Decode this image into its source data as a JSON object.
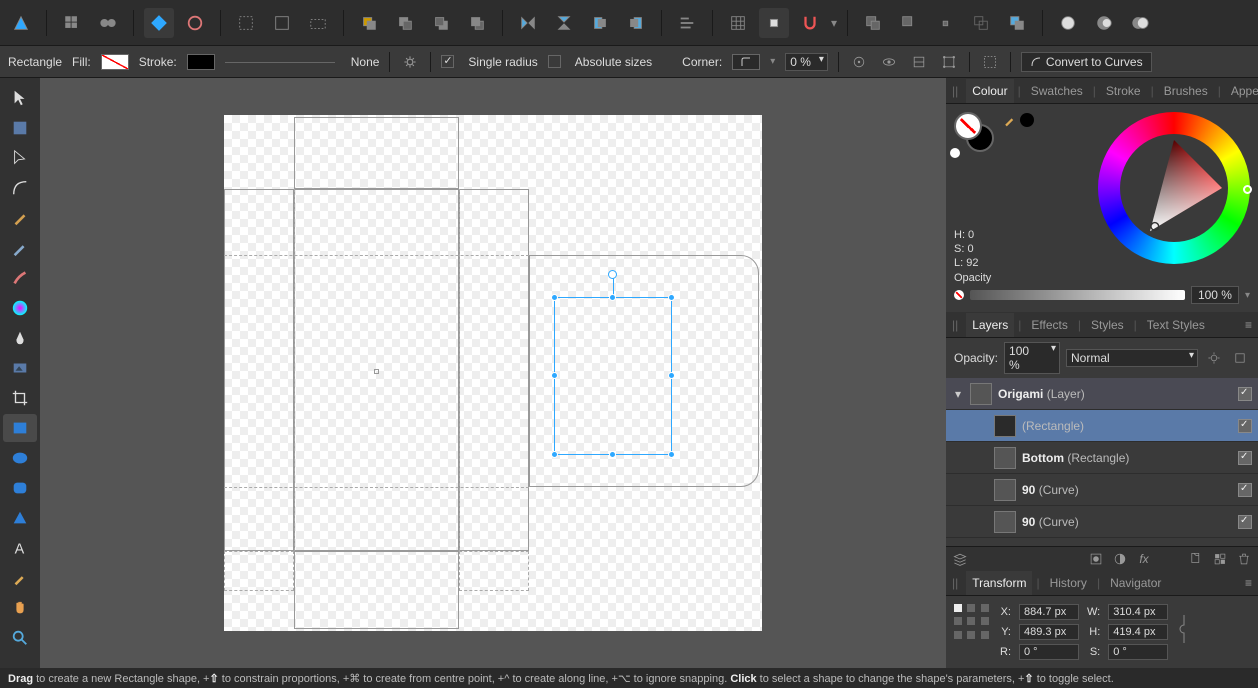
{
  "app": {
    "name": "Affinity Designer"
  },
  "context": {
    "tool_name": "Rectangle",
    "fill_label": "Fill:",
    "stroke_label": "Stroke:",
    "stroke_width_label": "None",
    "single_radius_label": "Single radius",
    "absolute_sizes_label": "Absolute sizes",
    "corner_label": "Corner:",
    "corner_value": "0 %",
    "convert_label": "Convert to Curves"
  },
  "color_panel": {
    "tabs": [
      "Colour",
      "Swatches",
      "Stroke",
      "Brushes",
      "Appearance"
    ],
    "hsl": {
      "h": "H: 0",
      "s": "S: 0",
      "l": "L: 92"
    },
    "opacity_label": "Opacity",
    "opacity_value": "100 %"
  },
  "layers_panel": {
    "tabs": [
      "Layers",
      "Effects",
      "Styles",
      "Text Styles"
    ],
    "opacity_label": "Opacity:",
    "opacity_value": "100 %",
    "blend_mode": "Normal",
    "items": [
      {
        "name": "Origami",
        "type": "(Layer)",
        "indent": 0,
        "group": true,
        "open": true,
        "visible": true
      },
      {
        "name": "",
        "type": "(Rectangle)",
        "indent": 1,
        "selected": true,
        "visible": true
      },
      {
        "name": "Bottom",
        "type": "(Rectangle)",
        "indent": 1,
        "visible": true
      },
      {
        "name": "90",
        "type": "(Curve)",
        "indent": 1,
        "visible": true
      },
      {
        "name": "90",
        "type": "(Curve)",
        "indent": 1,
        "visible": true
      }
    ]
  },
  "transform_panel": {
    "tabs": [
      "Transform",
      "History",
      "Navigator"
    ],
    "x_label": "X:",
    "x": "884.7 px",
    "y_label": "Y:",
    "y": "489.3 px",
    "w_label": "W:",
    "w": "310.4 px",
    "h_label": "H:",
    "h": "419.4 px",
    "r_label": "R:",
    "r": "0 °",
    "s_label": "S:",
    "s": "0 °"
  },
  "status": {
    "drag": "Drag",
    "drag_text": " to create a new Rectangle shape, +",
    "shift": "⇧",
    "shift_text": " to constrain proportions, +⌘ to create from centre point, +^ to create along line, +⌥ to ignore snapping. ",
    "click": "Click",
    "click_text": " to select a shape to change the shape's parameters, +",
    "shift2": "⇧",
    "shift2_text": " to toggle select."
  },
  "tools": [
    "move",
    "artboard",
    "node",
    "corner",
    "pen",
    "pencil",
    "brush",
    "gradient",
    "transparency",
    "place-image",
    "crop",
    "rectangle",
    "ellipse",
    "rounded-rect",
    "triangle",
    "text",
    "eyedropper",
    "hand",
    "zoom"
  ]
}
